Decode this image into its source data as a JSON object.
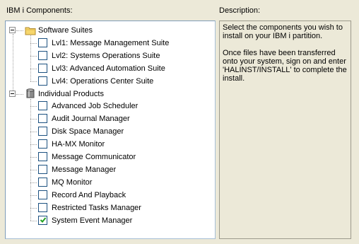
{
  "labels": {
    "components": "IBM i Components:",
    "description": "Description:"
  },
  "description": {
    "paragraphs": [
      "Select the components you wish to install on your IBM i partition.",
      "Once files have been transferred onto your system, sign on and enter 'HALINST/INSTALL' to complete the install."
    ]
  },
  "tree": {
    "categories": [
      {
        "label": "Software Suites",
        "icon": "folder-icon",
        "expanded": true,
        "items": [
          {
            "label": "Lvl1: Message Management Suite",
            "checked": false
          },
          {
            "label": "Lvl2: Systems Operations Suite",
            "checked": false
          },
          {
            "label": "Lvl3: Advanced Automation Suite",
            "checked": false
          },
          {
            "label": "Lvl4: Operations Center Suite",
            "checked": false
          }
        ]
      },
      {
        "label": "Individual Products",
        "icon": "database-icon",
        "expanded": true,
        "items": [
          {
            "label": "Advanced Job Scheduler",
            "checked": false
          },
          {
            "label": "Audit Journal Manager",
            "checked": false
          },
          {
            "label": "Disk Space Manager",
            "checked": false
          },
          {
            "label": "HA-MX Monitor",
            "checked": false
          },
          {
            "label": "Message Communicator",
            "checked": false
          },
          {
            "label": "Message Manager",
            "checked": false
          },
          {
            "label": "MQ Monitor",
            "checked": false
          },
          {
            "label": "Record And Playback",
            "checked": false
          },
          {
            "label": "Restricted Tasks Manager",
            "checked": false
          },
          {
            "label": "System Event Manager",
            "checked": true
          }
        ]
      }
    ]
  },
  "colors": {
    "window_bg": "#ece9d8",
    "checkbox_border": "#1c5180",
    "check_mark": "#21a121"
  }
}
